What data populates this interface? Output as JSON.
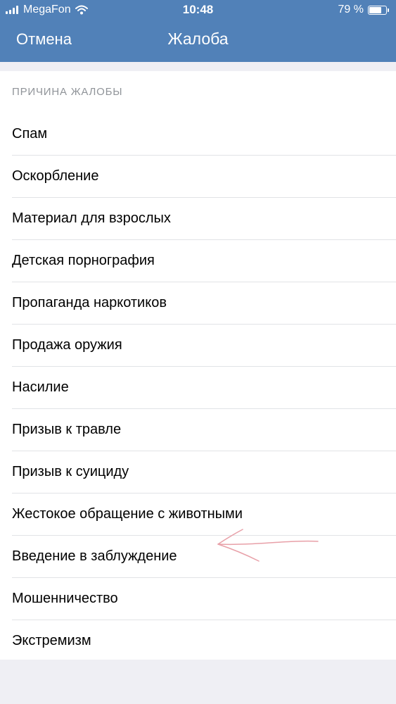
{
  "status_bar": {
    "carrier": "MegaFon",
    "time": "10:48",
    "battery_text": "79 %",
    "battery_level": 0.79,
    "icons": [
      "signal-icon",
      "wifi-icon",
      "battery-icon"
    ]
  },
  "nav": {
    "cancel_label": "Отмена",
    "title": "Жалоба"
  },
  "section": {
    "title": "ПРИЧИНА ЖАЛОБЫ"
  },
  "reasons": [
    "Спам",
    "Оскорбление",
    "Материал для взрослых",
    "Детская порнография",
    "Пропаганда наркотиков",
    "Продажа оружия",
    "Насилие",
    "Призыв к травле",
    "Призыв к суициду",
    "Жестокое обращение с животными",
    "Введение в заблуждение",
    "Мошенничество",
    "Экстремизм"
  ],
  "colors": {
    "header_bg": "#5181b8",
    "page_bg": "#efeff4",
    "annotation_arrow": "#e8a0a8"
  }
}
